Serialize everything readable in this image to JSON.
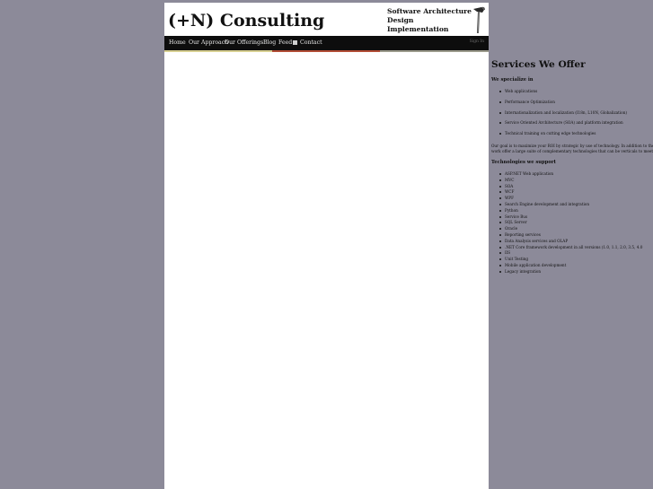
{
  "header": {
    "logo": "(+N) Consulting",
    "tagline": [
      "Software Architecture",
      "Design",
      "Implementation"
    ]
  },
  "nav": {
    "items": [
      "Home",
      "Our Approach",
      "Our Offerings",
      "Blog",
      "Feed",
      "Contact"
    ],
    "sign_in": "Sign In"
  },
  "stripe_colors": [
    "#d7d091",
    "#b2b2ac",
    "#b24d36",
    "#9b9a8b"
  ],
  "content": {
    "title": "Services We Offer",
    "specialize_heading": "We specialize in",
    "specialize_items": [
      "Web applications",
      "Performance Optimization",
      "Internationalization and localization (I18n, L10N, Globalization)",
      "Service Oriented Architecture (SOA) and platform integration",
      "Technical training on cutting edge technologies"
    ],
    "goal_text": [
      "Our goal is to maximize your ROI by strategic by use of technology. In addition to the w",
      "work offer a large suite of complementary technologies that can be verticals to meet your"
    ],
    "tech_heading": "Technologies we support",
    "tech_items": [
      "ASP.NET Web application",
      "MVC",
      "SOA",
      "WCF",
      "WPF",
      "Search Engine development and integration",
      "Python",
      "Service Bus",
      "SQL Server",
      "Oracle",
      "Reporting services",
      "Data Analysis services and OLAP",
      ".NET Core framework development in all versions (1.0, 1.1, 2.0, 3.5, 4.0",
      "IIS",
      "Unit Testing",
      "Mobile application development",
      "Legacy integration"
    ]
  }
}
